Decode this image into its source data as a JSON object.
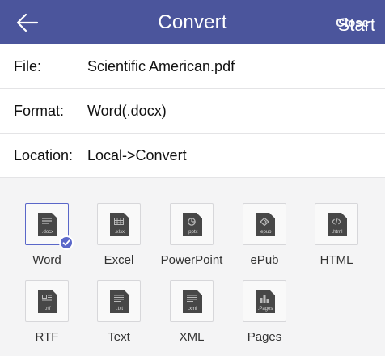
{
  "header": {
    "title": "Convert",
    "back_icon": "arrow-left-icon",
    "action_label": "Start",
    "action_overlay_label": "Close",
    "background": "#4b559c"
  },
  "fields": [
    {
      "label": "File:",
      "value": "Scientific American.pdf"
    },
    {
      "label": "Format:",
      "value": "Word(.docx)"
    },
    {
      "label": "Location:",
      "value": "Local->Convert"
    }
  ],
  "formats": [
    {
      "name": "Word",
      "ext": ".docx",
      "icon": "word-doc-icon",
      "selected": true
    },
    {
      "name": "Excel",
      "ext": ".xlsx",
      "icon": "excel-doc-icon",
      "selected": false
    },
    {
      "name": "PowerPoint",
      "ext": ".pptx",
      "icon": "powerpoint-doc-icon",
      "selected": false
    },
    {
      "name": "ePub",
      "ext": ".epub",
      "icon": "epub-doc-icon",
      "selected": false
    },
    {
      "name": "HTML",
      "ext": ".html",
      "icon": "html-doc-icon",
      "selected": false
    },
    {
      "name": "RTF",
      "ext": ".rtf",
      "icon": "rtf-doc-icon",
      "selected": false
    },
    {
      "name": "Text",
      "ext": ".txt",
      "icon": "text-doc-icon",
      "selected": false
    },
    {
      "name": "XML",
      "ext": ".xml",
      "icon": "xml-doc-icon",
      "selected": false
    },
    {
      "name": "Pages",
      "ext": ".Pages",
      "icon": "pages-doc-icon",
      "selected": false
    }
  ],
  "accent": "#5a67c9"
}
